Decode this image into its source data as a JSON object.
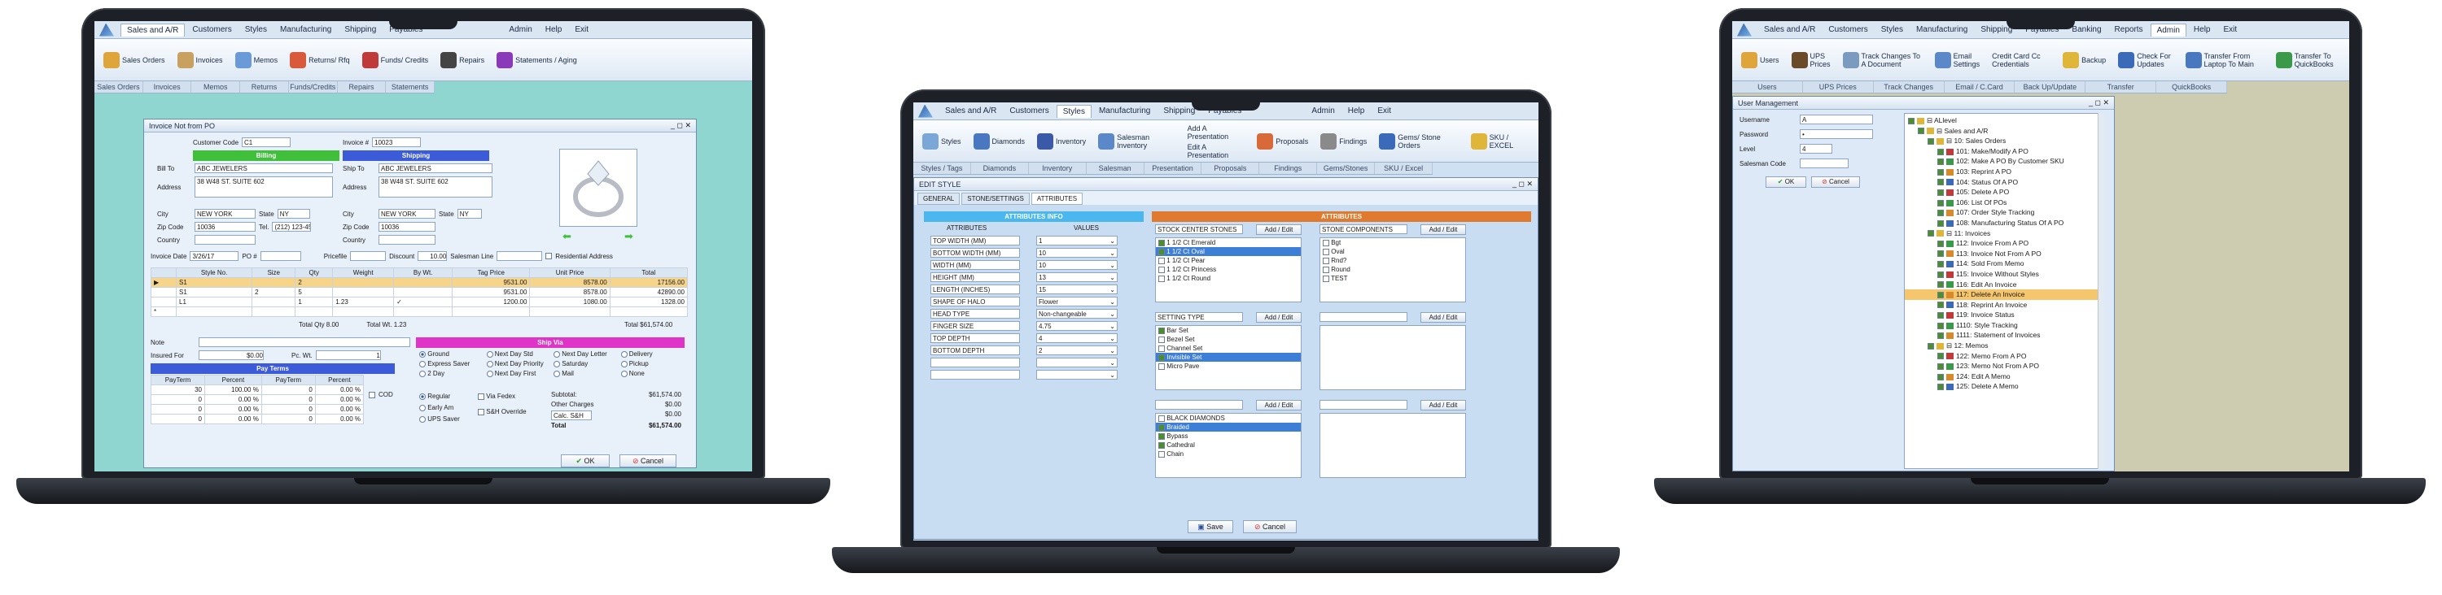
{
  "laptop1": {
    "menu": [
      "Sales and A/R",
      "Customers",
      "Styles",
      "Manufacturing",
      "Shipping",
      "Payables",
      "Admin",
      "Help",
      "Exit"
    ],
    "ribbon": [
      "Sales Orders",
      "Invoices",
      "Memos",
      "Returns/ Rfq",
      "Funds/ Credits",
      "Repairs",
      "Statements / Aging"
    ],
    "groups": [
      "Sales Orders",
      "Invoices",
      "Memos",
      "Returns",
      "Funds/Credits",
      "Repairs",
      "Statements"
    ],
    "window_title": "Invoice Not from PO",
    "customer_code_label": "Customer Code",
    "customer_code": "C1",
    "invoice_label": "Invoice #",
    "invoice_no": "10023",
    "billing_header": "Billing",
    "shipping_header": "Shipping",
    "bill_to_label": "Bill To",
    "bill_to": "ABC JEWELERS",
    "address_label": "Address",
    "bill_address": "38 W48 ST. SUITE 602",
    "ship_to_label": "Ship To",
    "ship_to": "ABC JEWELERS",
    "ship_address": "38 W48 ST. SUITE 602",
    "city_label": "City",
    "bill_city": "NEW YORK",
    "state_label": "State",
    "bill_state": "NY",
    "ship_city": "NEW YORK",
    "ship_state": "NY",
    "zip_label": "Zip Code",
    "bill_zip": "10036",
    "tel_label": "Tel.",
    "bill_tel": "(212) 123-4567",
    "ship_zip": "10036",
    "country_label": "Country",
    "invoice_date_label": "Invoice Date",
    "invoice_date": "3/26/17",
    "po_label": "PO #",
    "pricefile_label": "Pricefile",
    "discount_label": "Discount",
    "discount": "10.00",
    "salesman_label": "Salesman Line",
    "residential_label": "Residential Address",
    "table_headers": [
      "",
      "Style No.",
      "Size",
      "Qty",
      "Weight",
      "By Wt.",
      "Tag Price",
      "Unit Price",
      "Total"
    ],
    "rows": [
      [
        "▶",
        "S1",
        "",
        "2",
        "",
        "",
        "9531.00",
        "8578.00",
        "17156.00"
      ],
      [
        "",
        "S1",
        "2",
        "5",
        "",
        "",
        "9531.00",
        "8578.00",
        "42890.00"
      ],
      [
        "",
        "L1",
        "",
        "1",
        "1.23",
        "✓",
        "1200.00",
        "1080.00",
        "1328.00"
      ],
      [
        "*",
        "",
        "",
        "",
        "",
        "",
        "",
        "",
        ""
      ]
    ],
    "total_qty": "Total Qty 8.00",
    "total_wt": "Total Wt. 1.23",
    "total": "Total $61,574.00",
    "note_label": "Note",
    "insured_label": "Insured For",
    "insured": "$0.00",
    "pc_wt_label": "Pc. Wt.",
    "pc_wt": "1",
    "pay_terms_header": "Pay Terms",
    "pay_headers": [
      "PayTerm",
      "Percent",
      "PayTerm",
      "Percent"
    ],
    "pay_rows": [
      [
        "30",
        "100.00 %",
        "0",
        "0.00 %"
      ],
      [
        "0",
        "0.00 %",
        "0",
        "0.00 %"
      ],
      [
        "0",
        "0.00 %",
        "0",
        "0.00 %"
      ],
      [
        "0",
        "0.00 %",
        "0",
        "0.00 %"
      ]
    ],
    "cod_label": "COD",
    "ship_via_header": "Ship Via",
    "ship_via": [
      "Ground",
      "Next Day Std",
      "Next Day Letter",
      "Delivery",
      "Express Saver",
      "Next Day Priority",
      "Saturday",
      "Pickup",
      "2 Day",
      "Next Day First",
      "Mail",
      "None"
    ],
    "ship_speed": [
      "Regular",
      "Early Am",
      "UPS Saver"
    ],
    "via_fedex": "Via Fedex",
    "sh_override": "S&H Override",
    "subtotal_label": "Subtotal:",
    "subtotal": "$61,574.00",
    "other_charges_label": "Other Charges",
    "other_charges": "$0.00",
    "calc_sh": "Calc. S&H",
    "sh_value": "$0.00",
    "total_label": "Total",
    "grand_total": "$61,574.00",
    "ok": "OK",
    "cancel": "Cancel"
  },
  "laptop2": {
    "menu": [
      "Sales and A/R",
      "Customers",
      "Styles",
      "Manufacturing",
      "Shipping",
      "Payables",
      "Admin",
      "Help",
      "Exit"
    ],
    "ribbon": [
      "Styles",
      "Diamonds",
      "Inventory",
      "Salesman Inventory",
      "Add A Presentation",
      "Edit A Presentation",
      "Proposals",
      "Findings",
      "Gems/ Stone Orders",
      "SKU / EXCEL"
    ],
    "groups": [
      "Styles / Tags",
      "Diamonds",
      "Inventory",
      "Salesman Inventory",
      "Presentation",
      "Proposals",
      "Findings",
      "Gems/Stones",
      "SKU / Excel"
    ],
    "window_title": "EDIT STYLE",
    "tabs": [
      "GENERAL",
      "STONE/SETTINGS",
      "ATTRIBUTES"
    ],
    "attr_header": "ATTRIBUTES INFO",
    "attr_col1": "ATTRIBUTES",
    "attr_col2": "VALUES",
    "attrs": [
      [
        "TOP WIDTH (MM)",
        "1"
      ],
      [
        "BOTTOM WIDTH (MM)",
        "10"
      ],
      [
        "WIDTH (MM)",
        "10"
      ],
      [
        "HEIGHT (MM)",
        "13"
      ],
      [
        "LENGTH (INCHES)",
        "15"
      ],
      [
        "SHAPE OF HALO",
        "Flower"
      ],
      [
        "HEAD TYPE",
        "Non-changeable"
      ],
      [
        "FINGER SIZE",
        "4.75"
      ],
      [
        "TOP DEPTH",
        "4"
      ],
      [
        "BOTTOM DEPTH",
        "2"
      ],
      [
        "",
        ""
      ],
      [
        "",
        ""
      ]
    ],
    "attributes_header": "ATTRIBUTES",
    "stock_center_label": "STOCK CENTER STONES",
    "add_edit": "Add / Edit",
    "stock_center": [
      "1 1/2 Ct Emerald",
      "1 1/2 Ct Oval",
      "1 1/2 Ct Pear",
      "1 1/2 Ct Princess",
      "1 1/2 Ct Round"
    ],
    "stone_components_label": "STONE COMPONENTS",
    "stone_components": [
      "Bgt",
      "Oval",
      "Rnd?",
      "Round",
      "TEST"
    ],
    "setting_type_label": "SETTING TYPE",
    "setting_types": [
      "Bar Set",
      "Bezel Set",
      "Channel Set",
      "Invisible Set",
      "Micro Pave"
    ],
    "diamonds_list": [
      "BLACK DIAMONDS",
      "Braided",
      "Bypass",
      "Cathedral",
      "Chain"
    ],
    "save": "Save",
    "cancel": "Cancel"
  },
  "laptop3": {
    "menu": [
      "Sales and A/R",
      "Customers",
      "Styles",
      "Manufacturing",
      "Shipping",
      "Payables",
      "Banking",
      "Reports",
      "Admin",
      "Help",
      "Exit"
    ],
    "ribbon": [
      "Users",
      "UPS Prices",
      "Track Changes To A Document",
      "Email Settings",
      "Credit Card Cc Credentials",
      "Backup",
      "Check For Updates",
      "Transfer From Laptop To Main",
      "Transfer To QuickBooks"
    ],
    "groups": [
      "Users",
      "UPS Prices",
      "Track Changes",
      "Email / C.Card",
      "Back Up/Update",
      "Transfer",
      "QuickBooks"
    ],
    "window_title": "User Management",
    "username_label": "Username",
    "username": "A",
    "password_label": "Password",
    "password": "•",
    "level_label": "Level",
    "level": "4",
    "salesman_code_label": "Salesman Code",
    "ok": "OK",
    "cancel": "Cancel",
    "tree": [
      {
        "t": "⊟ ALlevel",
        "d": 0
      },
      {
        "t": "⊟ Sales and A/R",
        "d": 1
      },
      {
        "t": "⊟ 10: Sales Orders",
        "d": 2
      },
      {
        "t": "101: Make/Modify A PO",
        "d": 3
      },
      {
        "t": "102: Make A PO By Customer SKU",
        "d": 3
      },
      {
        "t": "103: Reprint A PO",
        "d": 3
      },
      {
        "t": "104: Status Of A PO",
        "d": 3
      },
      {
        "t": "105: Delete A PO",
        "d": 3
      },
      {
        "t": "106: List Of POs",
        "d": 3
      },
      {
        "t": "107: Order Style Tracking",
        "d": 3
      },
      {
        "t": "108: Manufacturing Status Of A PO",
        "d": 3
      },
      {
        "t": "⊟ 11: Invoices",
        "d": 2
      },
      {
        "t": "112: Invoice From A PO",
        "d": 3
      },
      {
        "t": "113: Invoice Not From A PO",
        "d": 3
      },
      {
        "t": "114: Sold From Memo",
        "d": 3
      },
      {
        "t": "115: Invoice Without Styles",
        "d": 3
      },
      {
        "t": "116: Edit An Invoice",
        "d": 3
      },
      {
        "t": "117: Delete An Invoice",
        "d": 3
      },
      {
        "t": "118: Reprint An Invoice",
        "d": 3
      },
      {
        "t": "119: Invoice Status",
        "d": 3
      },
      {
        "t": "1110: Style Tracking",
        "d": 3
      },
      {
        "t": "1111: Statement of Invoices",
        "d": 3
      },
      {
        "t": "⊟ 12: Memos",
        "d": 2
      },
      {
        "t": "122: Memo From A PO",
        "d": 3
      },
      {
        "t": "123: Memo Not From A PO",
        "d": 3
      },
      {
        "t": "124: Edit A Memo",
        "d": 3
      },
      {
        "t": "125: Delete A Memo",
        "d": 3
      }
    ],
    "tree_selected": 17
  }
}
